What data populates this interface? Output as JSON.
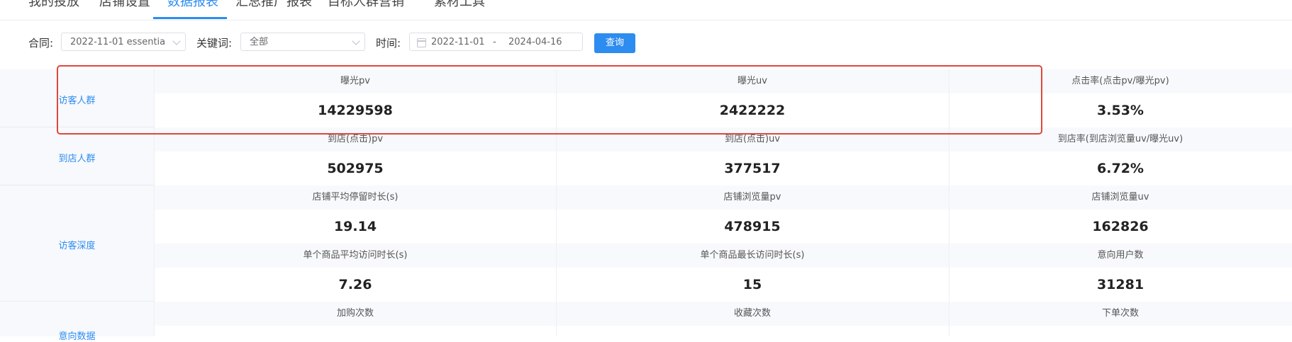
{
  "tabs": [
    {
      "label": "我的投放",
      "active": false
    },
    {
      "label": "店铺设置",
      "active": false
    },
    {
      "label": "数据报表",
      "active": true
    },
    {
      "label": "汇总推广报表",
      "active": false
    },
    {
      "label": "目标人群营销",
      "active": false
    },
    {
      "label": "素材工具",
      "active": false
    }
  ],
  "filters": {
    "contract_label": "合同:",
    "contract_value": "2022-11-01 essentia",
    "keyword_label": "关键词:",
    "keyword_value": "全部",
    "time_label": "时间:",
    "date_start": "2022-11-01",
    "date_sep": "-",
    "date_end": "2024-04-16",
    "query_button": "查询"
  },
  "sections": [
    {
      "name": "访客人群",
      "rows": [
        {
          "headers": [
            "曝光pv",
            "曝光uv",
            "点击率(点击pv/曝光pv)"
          ],
          "values": [
            "14229598",
            "2422222",
            "3.53%"
          ]
        }
      ]
    },
    {
      "name": "到店人群",
      "rows": [
        {
          "headers": [
            "到店(点击)pv",
            "到店(点击)uv",
            "到店率(到店浏览量uv/曝光uv)"
          ],
          "values": [
            "502975",
            "377517",
            "6.72%"
          ]
        }
      ]
    },
    {
      "name": "访客深度",
      "rows": [
        {
          "headers": [
            "店铺平均停留时长(s)",
            "店铺浏览量pv",
            "店铺浏览量uv"
          ],
          "values": [
            "19.14",
            "478915",
            "162826"
          ]
        },
        {
          "headers": [
            "单个商品平均访问时长(s)",
            "单个商品最长访问时长(s)",
            "意向用户数"
          ],
          "values": [
            "7.26",
            "15",
            "31281"
          ]
        }
      ]
    },
    {
      "name": "意向数据",
      "rows": [
        {
          "headers": [
            "加购次数",
            "收藏次数",
            "下单次数"
          ],
          "values": [
            "",
            "",
            ""
          ]
        }
      ]
    }
  ],
  "colors": {
    "accent": "#2d8cf0",
    "highlight": "#e0473c"
  }
}
